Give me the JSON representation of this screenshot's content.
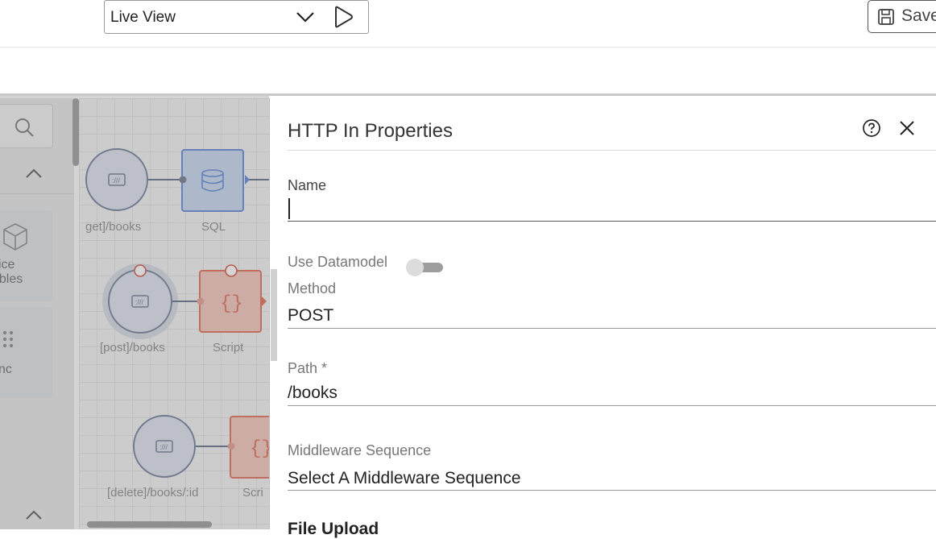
{
  "toolbar": {
    "view_select_value": "Live View",
    "save_label": "Save"
  },
  "palette": {
    "cards": [
      {
        "label_line1": "vice",
        "label_line2": "ables"
      },
      {
        "label_line1": "ync",
        "label_line2": ""
      }
    ]
  },
  "canvas": {
    "nodes": [
      {
        "label": "get]/books"
      },
      {
        "label": "SQL"
      },
      {
        "label": "[post]/books"
      },
      {
        "label": "Script"
      },
      {
        "label": "[delete]/books/:id"
      },
      {
        "label": "Scri"
      }
    ]
  },
  "panel": {
    "title": "HTTP In Properties",
    "fields": {
      "name_label": "Name",
      "name_value": "",
      "use_datamodel_label": "Use Datamodel",
      "method_label": "Method",
      "method_value": "POST",
      "path_label": "Path *",
      "path_value": "/books",
      "middleware_label": "Middleware Sequence",
      "middleware_value": "Select A Middleware Sequence",
      "next_section_label": "File Upload"
    }
  }
}
